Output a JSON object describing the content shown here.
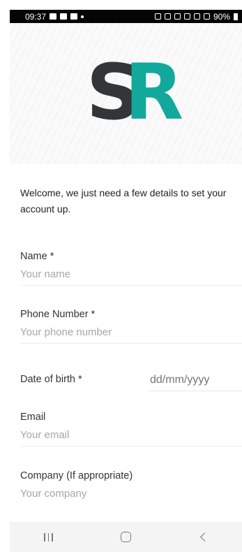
{
  "status_bar": {
    "time": "09:37",
    "battery": "90%"
  },
  "logo": {
    "left_letter": "S",
    "right_letter": "R",
    "left_color": "#333638",
    "right_color": "#12a89c"
  },
  "welcome_text": "Welcome, we just need a few details to set your account up.",
  "form": {
    "name": {
      "label": "Name *",
      "placeholder": "Your name"
    },
    "phone": {
      "label": "Phone Number *",
      "placeholder": "Your phone number"
    },
    "dob": {
      "label": "Date of birth *",
      "placeholder": "dd/mm/yyyy"
    },
    "email": {
      "label": "Email",
      "placeholder": "Your email"
    },
    "company": {
      "label": "Company (If appropriate)",
      "placeholder": "Your company"
    }
  },
  "nav": {
    "recents": "recents-icon",
    "home": "home-icon",
    "back": "back-icon"
  }
}
